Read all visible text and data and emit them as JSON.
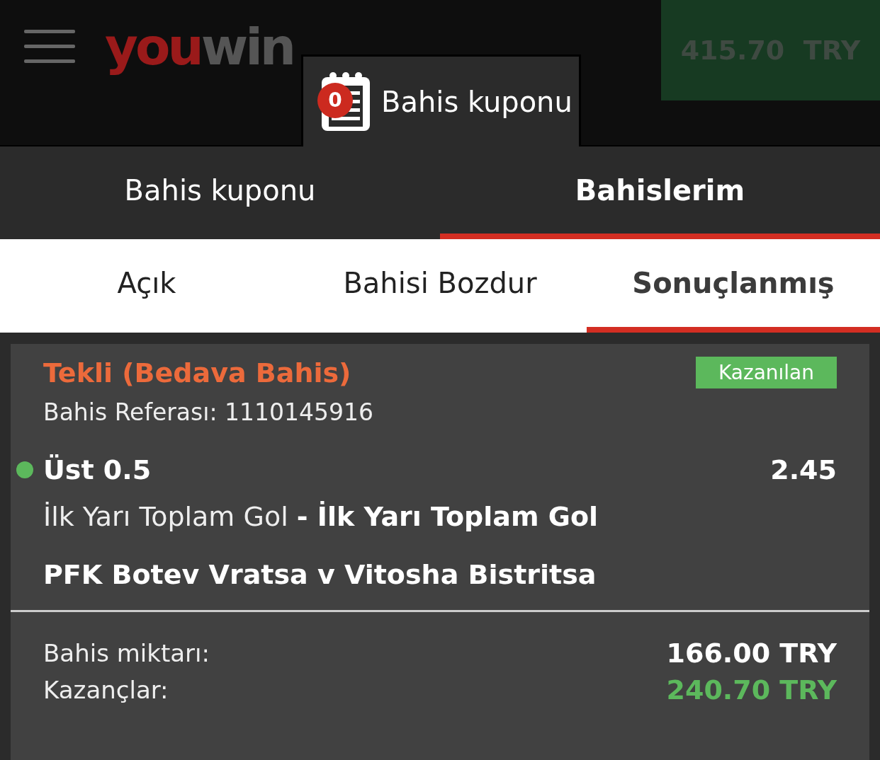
{
  "header": {
    "logo": {
      "part_1": "you",
      "part_2": "win"
    },
    "coupon_tab": {
      "label": "Bahis kuponu",
      "count": "0"
    },
    "balance": "415.70  TRY"
  },
  "main_tabs": [
    {
      "label": "Bahis kuponu",
      "selected": false
    },
    {
      "label": "Bahislerim",
      "selected": true
    }
  ],
  "sub_tabs": [
    {
      "label": "Açık",
      "selected": false
    },
    {
      "label": "Bahisi Bozdur",
      "selected": false
    },
    {
      "label": "Sonuçlanmış",
      "selected": true
    }
  ],
  "bet": {
    "title": "Tekli (Bedava Bahis)",
    "status": "Kazanılan",
    "reference": "Bahis Referası: 1110145916",
    "selection": {
      "name": "Üst 0.5",
      "odds": "2.45",
      "won": true,
      "market": "İlk Yarı Toplam Gol **- İlk Yarı Toplam Gol**",
      "event": "PFK Botev Vratsa v Vitosha Bistritsa"
    },
    "stake_label": "Bahis miktarı:",
    "stake": "166.00 TRY",
    "winnings_label": "Kazançlar:",
    "winnings": "240.70 TRY"
  }
}
